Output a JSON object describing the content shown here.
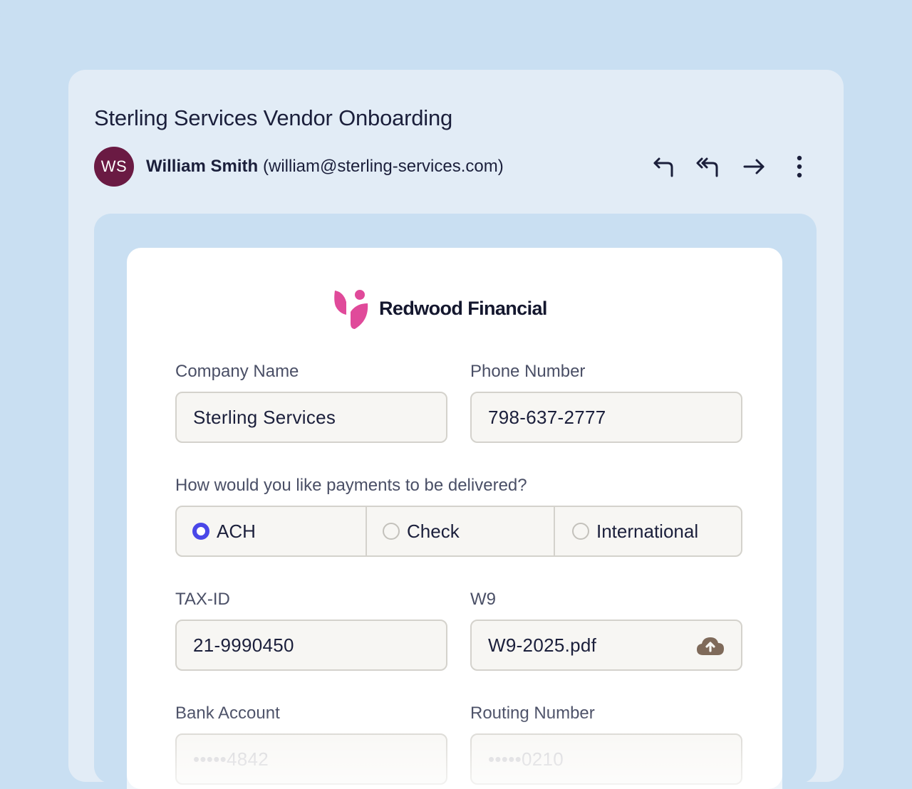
{
  "email": {
    "subject": "Sterling Services Vendor Onboarding",
    "sender": {
      "initials": "WS",
      "name": "William Smith",
      "email": "(william@sterling-services.com)"
    },
    "actions": [
      {
        "icon": "reply-icon"
      },
      {
        "icon": "reply-all-icon"
      },
      {
        "icon": "forward-icon"
      },
      {
        "icon": "more-vertical-icon"
      }
    ]
  },
  "form": {
    "brand": {
      "name": "Redwood Financial",
      "logo_color": "#e04a9a"
    },
    "company_name": {
      "label": "Company Name",
      "value": "Sterling Services"
    },
    "phone_number": {
      "label": "Phone Number",
      "value": "798-637-2777"
    },
    "payment": {
      "question": "How would you like payments to be delivered?",
      "options": [
        {
          "label": "ACH",
          "selected": true
        },
        {
          "label": "Check",
          "selected": false
        },
        {
          "label": "International",
          "selected": false
        }
      ],
      "accent_color": "#4a47e8"
    },
    "tax_id": {
      "label": "TAX-ID",
      "value": "21-9990450"
    },
    "w9": {
      "label": "W9",
      "value": "W9-2025.pdf",
      "icon": "cloud-upload-icon"
    },
    "bank_account": {
      "label": "Bank Account",
      "value": "•••••4842"
    },
    "routing_number": {
      "label": "Routing Number",
      "value": "•••••0210"
    }
  },
  "colors": {
    "background": "#c9dff2",
    "email_card": "#e2ecf6",
    "avatar": "#6a1a43",
    "text": "#1b1f3b"
  }
}
